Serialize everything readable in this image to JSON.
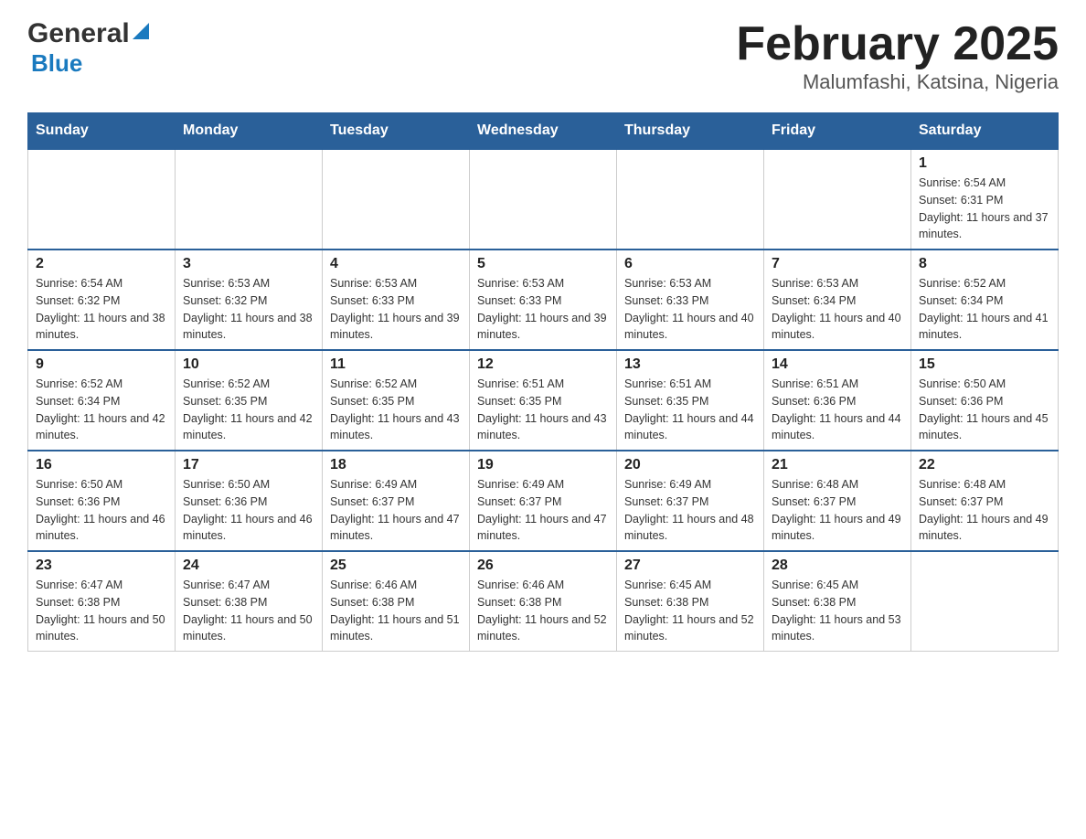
{
  "logo": {
    "general": "General",
    "blue": "Blue"
  },
  "title": "February 2025",
  "subtitle": "Malumfashi, Katsina, Nigeria",
  "days_of_week": [
    "Sunday",
    "Monday",
    "Tuesday",
    "Wednesday",
    "Thursday",
    "Friday",
    "Saturday"
  ],
  "weeks": [
    [
      {
        "day": "",
        "info": ""
      },
      {
        "day": "",
        "info": ""
      },
      {
        "day": "",
        "info": ""
      },
      {
        "day": "",
        "info": ""
      },
      {
        "day": "",
        "info": ""
      },
      {
        "day": "",
        "info": ""
      },
      {
        "day": "1",
        "info": "Sunrise: 6:54 AM\nSunset: 6:31 PM\nDaylight: 11 hours and 37 minutes."
      }
    ],
    [
      {
        "day": "2",
        "info": "Sunrise: 6:54 AM\nSunset: 6:32 PM\nDaylight: 11 hours and 38 minutes."
      },
      {
        "day": "3",
        "info": "Sunrise: 6:53 AM\nSunset: 6:32 PM\nDaylight: 11 hours and 38 minutes."
      },
      {
        "day": "4",
        "info": "Sunrise: 6:53 AM\nSunset: 6:33 PM\nDaylight: 11 hours and 39 minutes."
      },
      {
        "day": "5",
        "info": "Sunrise: 6:53 AM\nSunset: 6:33 PM\nDaylight: 11 hours and 39 minutes."
      },
      {
        "day": "6",
        "info": "Sunrise: 6:53 AM\nSunset: 6:33 PM\nDaylight: 11 hours and 40 minutes."
      },
      {
        "day": "7",
        "info": "Sunrise: 6:53 AM\nSunset: 6:34 PM\nDaylight: 11 hours and 40 minutes."
      },
      {
        "day": "8",
        "info": "Sunrise: 6:52 AM\nSunset: 6:34 PM\nDaylight: 11 hours and 41 minutes."
      }
    ],
    [
      {
        "day": "9",
        "info": "Sunrise: 6:52 AM\nSunset: 6:34 PM\nDaylight: 11 hours and 42 minutes."
      },
      {
        "day": "10",
        "info": "Sunrise: 6:52 AM\nSunset: 6:35 PM\nDaylight: 11 hours and 42 minutes."
      },
      {
        "day": "11",
        "info": "Sunrise: 6:52 AM\nSunset: 6:35 PM\nDaylight: 11 hours and 43 minutes."
      },
      {
        "day": "12",
        "info": "Sunrise: 6:51 AM\nSunset: 6:35 PM\nDaylight: 11 hours and 43 minutes."
      },
      {
        "day": "13",
        "info": "Sunrise: 6:51 AM\nSunset: 6:35 PM\nDaylight: 11 hours and 44 minutes."
      },
      {
        "day": "14",
        "info": "Sunrise: 6:51 AM\nSunset: 6:36 PM\nDaylight: 11 hours and 44 minutes."
      },
      {
        "day": "15",
        "info": "Sunrise: 6:50 AM\nSunset: 6:36 PM\nDaylight: 11 hours and 45 minutes."
      }
    ],
    [
      {
        "day": "16",
        "info": "Sunrise: 6:50 AM\nSunset: 6:36 PM\nDaylight: 11 hours and 46 minutes."
      },
      {
        "day": "17",
        "info": "Sunrise: 6:50 AM\nSunset: 6:36 PM\nDaylight: 11 hours and 46 minutes."
      },
      {
        "day": "18",
        "info": "Sunrise: 6:49 AM\nSunset: 6:37 PM\nDaylight: 11 hours and 47 minutes."
      },
      {
        "day": "19",
        "info": "Sunrise: 6:49 AM\nSunset: 6:37 PM\nDaylight: 11 hours and 47 minutes."
      },
      {
        "day": "20",
        "info": "Sunrise: 6:49 AM\nSunset: 6:37 PM\nDaylight: 11 hours and 48 minutes."
      },
      {
        "day": "21",
        "info": "Sunrise: 6:48 AM\nSunset: 6:37 PM\nDaylight: 11 hours and 49 minutes."
      },
      {
        "day": "22",
        "info": "Sunrise: 6:48 AM\nSunset: 6:37 PM\nDaylight: 11 hours and 49 minutes."
      }
    ],
    [
      {
        "day": "23",
        "info": "Sunrise: 6:47 AM\nSunset: 6:38 PM\nDaylight: 11 hours and 50 minutes."
      },
      {
        "day": "24",
        "info": "Sunrise: 6:47 AM\nSunset: 6:38 PM\nDaylight: 11 hours and 50 minutes."
      },
      {
        "day": "25",
        "info": "Sunrise: 6:46 AM\nSunset: 6:38 PM\nDaylight: 11 hours and 51 minutes."
      },
      {
        "day": "26",
        "info": "Sunrise: 6:46 AM\nSunset: 6:38 PM\nDaylight: 11 hours and 52 minutes."
      },
      {
        "day": "27",
        "info": "Sunrise: 6:45 AM\nSunset: 6:38 PM\nDaylight: 11 hours and 52 minutes."
      },
      {
        "day": "28",
        "info": "Sunrise: 6:45 AM\nSunset: 6:38 PM\nDaylight: 11 hours and 53 minutes."
      },
      {
        "day": "",
        "info": ""
      }
    ]
  ]
}
